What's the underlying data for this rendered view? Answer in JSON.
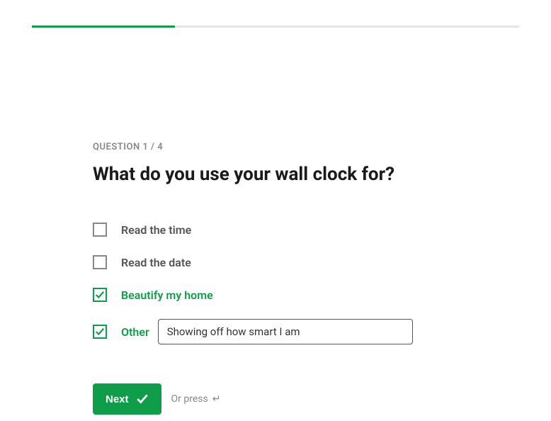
{
  "progress": {
    "percent": 29.3
  },
  "question": {
    "meta": "QUESTION 1 / 4",
    "title": "What do you use your wall clock for?"
  },
  "options": [
    {
      "label": "Read the time",
      "checked": false
    },
    {
      "label": "Read the date",
      "checked": false
    },
    {
      "label": "Beautify my home",
      "checked": true
    },
    {
      "label": "Other",
      "checked": true,
      "other_value": "Showing off how smart I am"
    }
  ],
  "footer": {
    "next_label": "Next",
    "or_press": "Or press",
    "enter_symbol": "↵"
  }
}
